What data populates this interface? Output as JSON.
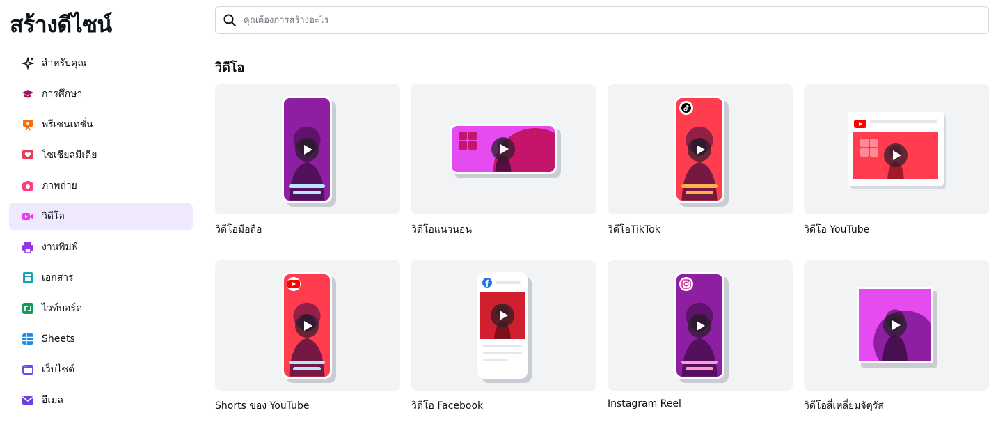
{
  "app": {
    "title": "สร้างดีไซน์"
  },
  "search": {
    "placeholder": "คุณต้องการสร้างอะไร"
  },
  "sidebar": {
    "items": [
      {
        "label": "สำหรับคุณ",
        "icon": "sparkle-icon",
        "color": "#0d1216"
      },
      {
        "label": "การศึกษา",
        "icon": "graduation-cap-icon",
        "color": "#a0175c"
      },
      {
        "label": "พรีเซนเทชั่น",
        "icon": "presentation-icon",
        "color": "#ff6b00"
      },
      {
        "label": "โซเชียลมีเดีย",
        "icon": "heart-icon",
        "color": "#ed3a57"
      },
      {
        "label": "ภาพถ่าย",
        "icon": "camera-icon",
        "color": "#ff3d7f"
      },
      {
        "label": "วิดีโอ",
        "icon": "video-camera-icon",
        "color": "#e93ff2",
        "active": true
      },
      {
        "label": "งานพิมพ์",
        "icon": "printer-icon",
        "color": "#9333ea"
      },
      {
        "label": "เอกสาร",
        "icon": "document-icon",
        "color": "#13a3b5"
      },
      {
        "label": "ไวท์บอร์ด",
        "icon": "whiteboard-icon",
        "color": "#0f9d58"
      },
      {
        "label": "Sheets",
        "icon": "spreadsheet-icon",
        "color": "#1e88e5"
      },
      {
        "label": "เว็บไซต์",
        "icon": "website-icon",
        "color": "#5b4ff5"
      },
      {
        "label": "อีเมล",
        "icon": "envelope-icon",
        "color": "#6c3fe0"
      }
    ]
  },
  "main": {
    "section_title": "วิดีโอ",
    "cards": [
      {
        "label": "วิดีโอมือถือ",
        "thumb": "phone",
        "bg": "#8e1fa3",
        "accent": "#b7e4ff"
      },
      {
        "label": "วิดีโอแนวนอน",
        "thumb": "landscape",
        "bg": "#e54bf0",
        "accent": "#c4156b"
      },
      {
        "label": "วิดีโอTikTok",
        "thumb": "phone",
        "bg": "#ff3d4f",
        "accent": "#ffb24a",
        "badge": "tiktok-icon"
      },
      {
        "label": "วิดีโอ YouTube",
        "thumb": "youtube",
        "bg": "#ff3d4f",
        "accent": "#ff0000"
      },
      {
        "label": "Shorts ของ YouTube",
        "thumb": "phone",
        "bg": "#ff3d4f",
        "accent": "#b7e4ff",
        "badge": "youtube-icon"
      },
      {
        "label": "วิดีโอ Facebook",
        "thumb": "facebook",
        "bg": "#d01f2e",
        "accent": "#1877f2"
      },
      {
        "label": "Instagram Reel",
        "thumb": "phone",
        "bg": "#8e1fa3",
        "accent": "#ff9ad5",
        "badge": "instagram-icon"
      },
      {
        "label": "วิดีโอสี่เหลี่ยมจัตุรัส",
        "thumb": "square",
        "bg": "#e54bf0",
        "accent": "#8e1fa3"
      }
    ]
  }
}
